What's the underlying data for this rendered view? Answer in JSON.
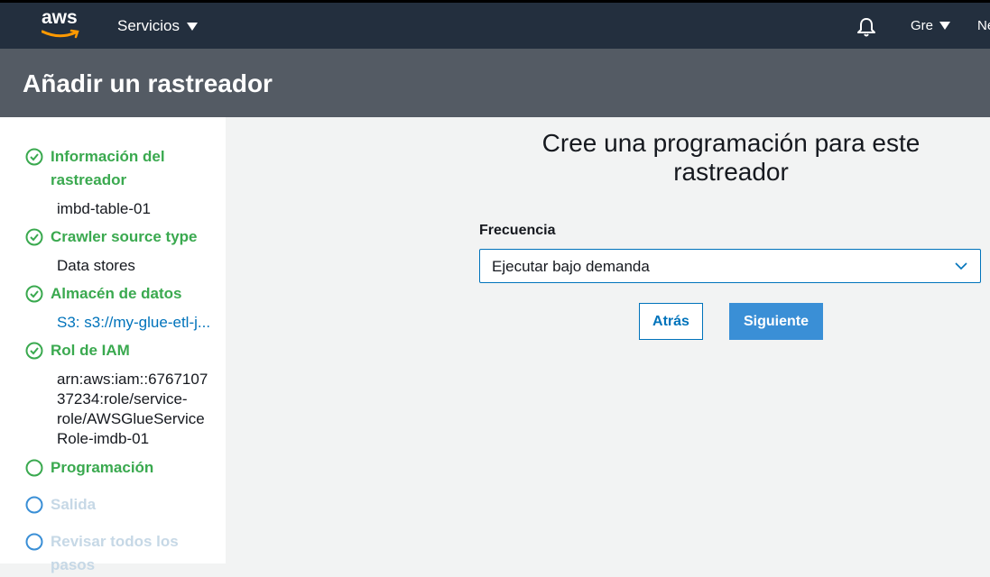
{
  "nav": {
    "logo_text": "aws",
    "services_label": "Servicios",
    "region_label": "Gre",
    "truncated_label": "Ne"
  },
  "page": {
    "title": "Añadir un rastreador"
  },
  "sidebar": {
    "steps": [
      {
        "label": "Información del rastreador",
        "detail": "imbd-table-01",
        "status": "done"
      },
      {
        "label": "Crawler source type",
        "detail": "Data stores",
        "status": "done"
      },
      {
        "label": "Almacén de datos",
        "detail": "S3: s3://my-glue-etl-j...",
        "status": "done"
      },
      {
        "label": "Rol de IAM",
        "detail": "arn:aws:iam::676710737234:role/service-role/AWSGlueServiceRole-imdb-01",
        "status": "done"
      },
      {
        "label": "Programación",
        "status": "current"
      },
      {
        "label": "Salida",
        "status": "todo"
      },
      {
        "label": "Revisar todos los pasos",
        "status": "todo"
      }
    ],
    "iam_lines": [
      "arn:aws:iam::6767107",
      "37234:role/service-",
      "role/AWSGlueService",
      "Role-imdb-01"
    ]
  },
  "main": {
    "heading_line1": "Cree una programación para este",
    "heading_line2": "rastreador",
    "frequency_label": "Frecuencia",
    "frequency_value": "Ejecutar bajo demanda",
    "back_label": "Atrás",
    "next_label": "Siguiente"
  },
  "colors": {
    "nav_bg": "#232f3e",
    "header_bg": "#545b64",
    "step_done": "#3aa94f",
    "step_todo": "#c6d8e6",
    "link": "#0073bb",
    "primary_button": "#3a8fd6"
  },
  "icons": {
    "bell": "bell-icon",
    "check": "check-circle-icon",
    "empty": "empty-circle-icon",
    "chevron": "chevron-down-icon"
  }
}
